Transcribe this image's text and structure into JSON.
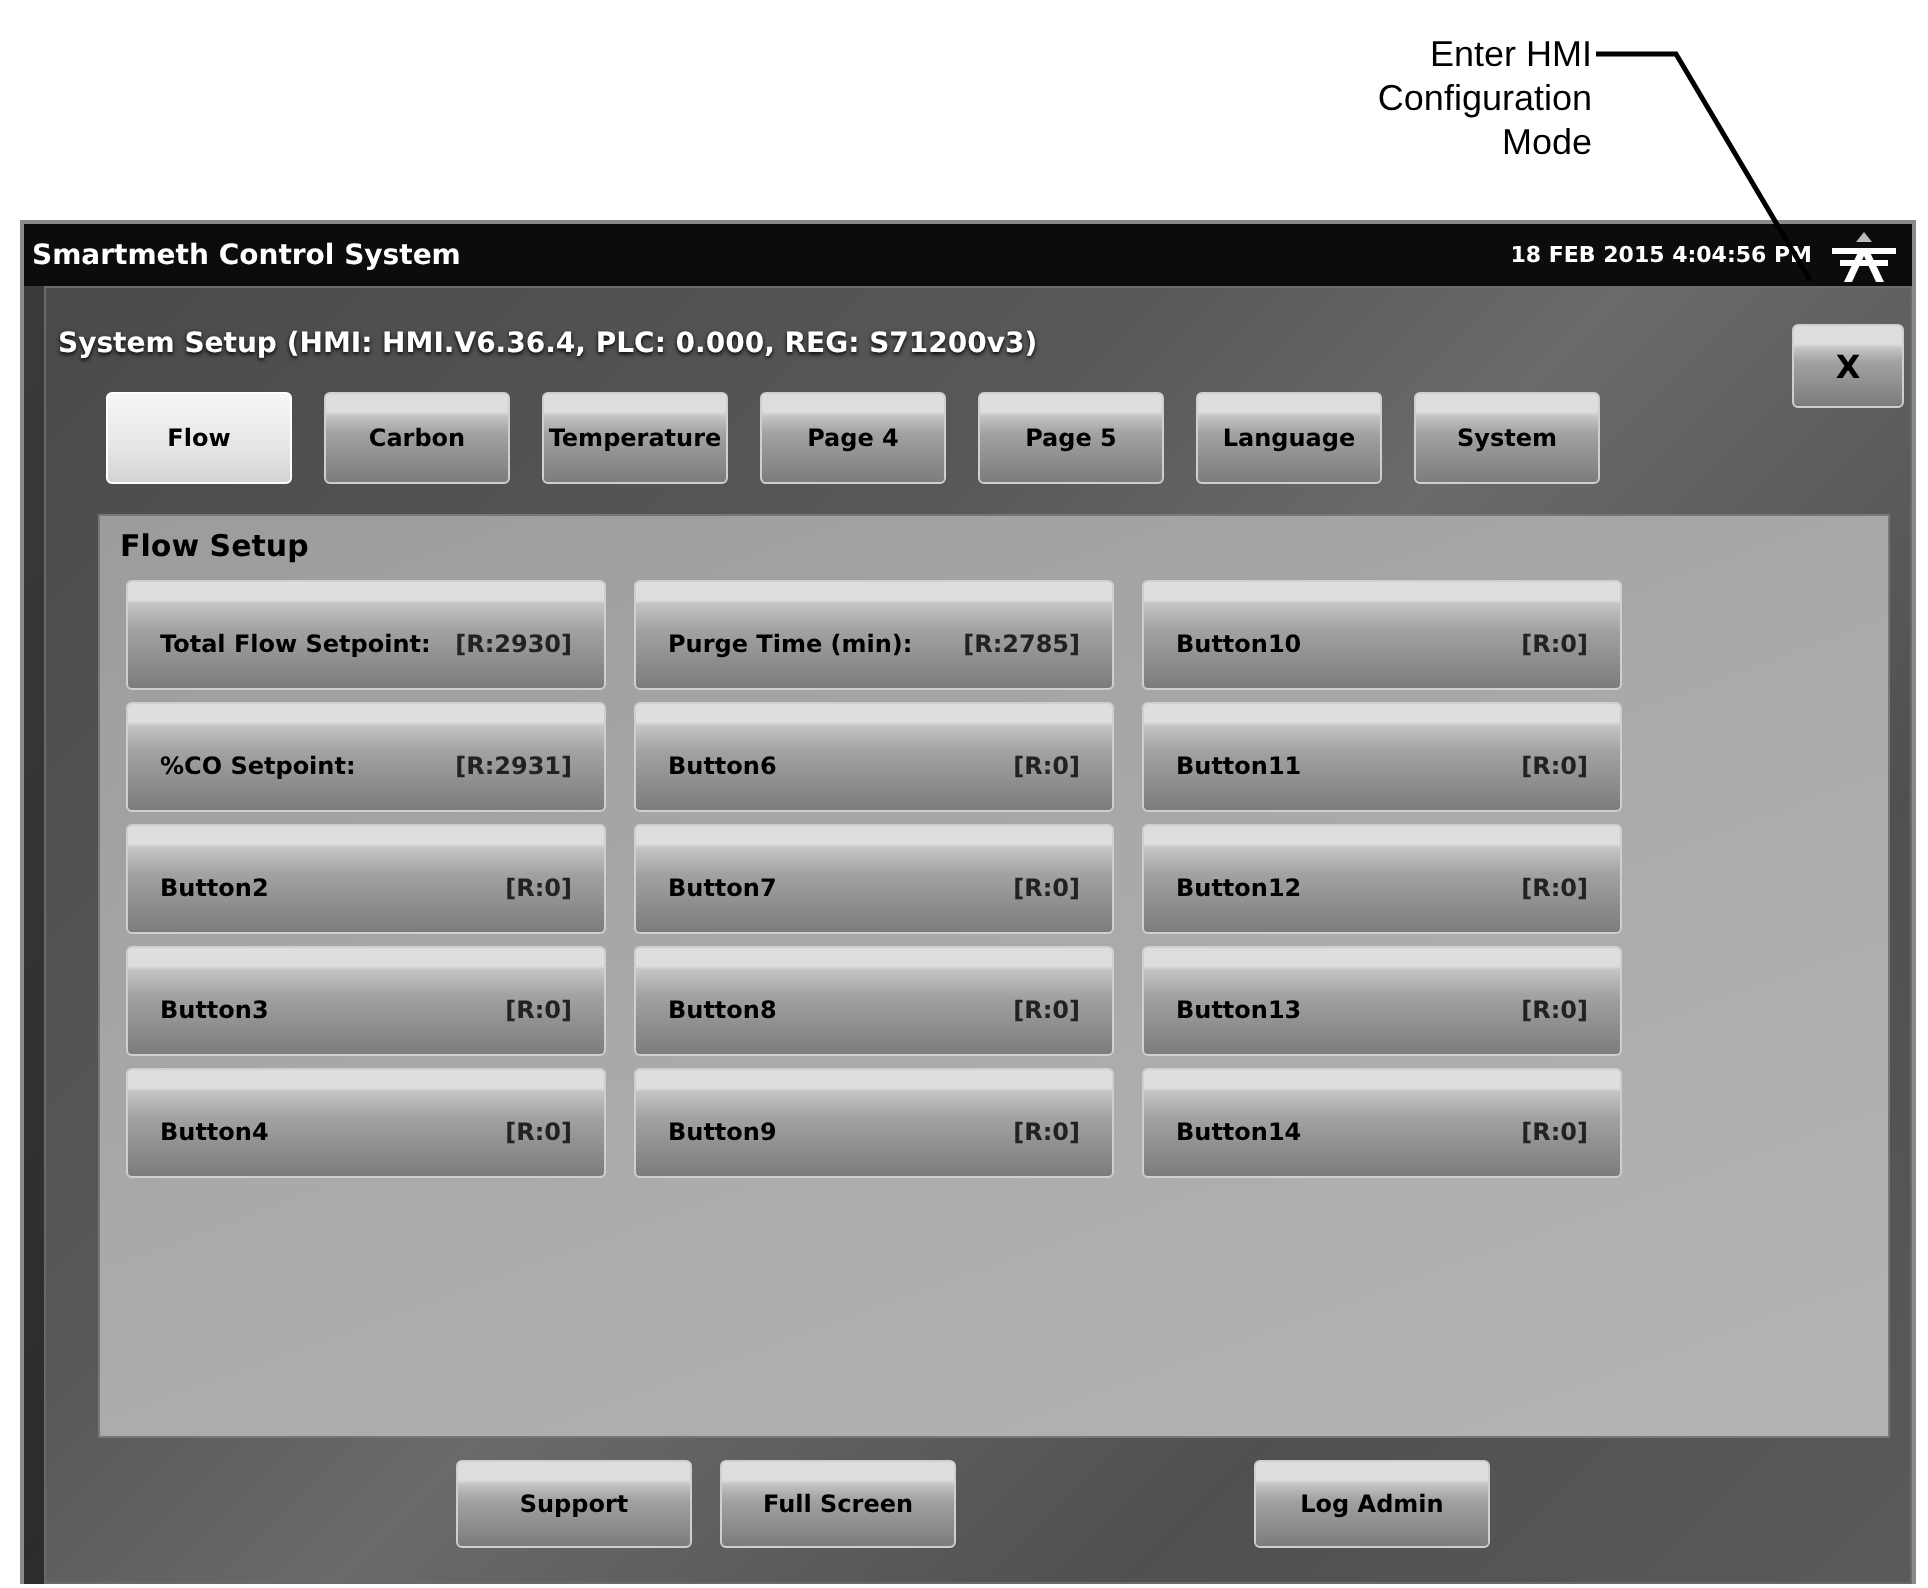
{
  "annotation": {
    "lines": [
      "Enter HMI",
      "Configuration",
      "Mode"
    ]
  },
  "window": {
    "title": "Smartmeth Control System",
    "datetime": "18 FEB 2015 4:04:56 PM"
  },
  "dialog": {
    "title": "System Setup (HMI: HMI.V6.36.4, PLC: 0.000, REG: S71200v3)",
    "close": "X",
    "tabs": [
      {
        "label": "Flow",
        "selected": true
      },
      {
        "label": "Carbon",
        "selected": false
      },
      {
        "label": "Temperature",
        "selected": false
      },
      {
        "label": "Page 4",
        "selected": false
      },
      {
        "label": "Page 5",
        "selected": false
      },
      {
        "label": "Language",
        "selected": false
      },
      {
        "label": "System",
        "selected": false
      }
    ],
    "panel": {
      "title": "Flow Setup",
      "buttons": [
        {
          "label": "Total Flow Setpoint:",
          "reading": "[R:2930]"
        },
        {
          "label": "Purge Time (min):",
          "reading": "[R:2785]"
        },
        {
          "label": "Button10",
          "reading": "[R:0]"
        },
        {
          "label": "%CO Setpoint:",
          "reading": "[R:2931]"
        },
        {
          "label": "Button6",
          "reading": "[R:0]"
        },
        {
          "label": "Button11",
          "reading": "[R:0]"
        },
        {
          "label": "Button2",
          "reading": "[R:0]"
        },
        {
          "label": "Button7",
          "reading": "[R:0]"
        },
        {
          "label": "Button12",
          "reading": "[R:0]"
        },
        {
          "label": "Button3",
          "reading": "[R:0]"
        },
        {
          "label": "Button8",
          "reading": "[R:0]"
        },
        {
          "label": "Button13",
          "reading": "[R:0]"
        },
        {
          "label": "Button4",
          "reading": "[R:0]"
        },
        {
          "label": "Button9",
          "reading": "[R:0]"
        },
        {
          "label": "Button14",
          "reading": "[R:0]"
        }
      ]
    },
    "footer_buttons": [
      "Support",
      "Full Screen",
      "Log Admin"
    ]
  }
}
